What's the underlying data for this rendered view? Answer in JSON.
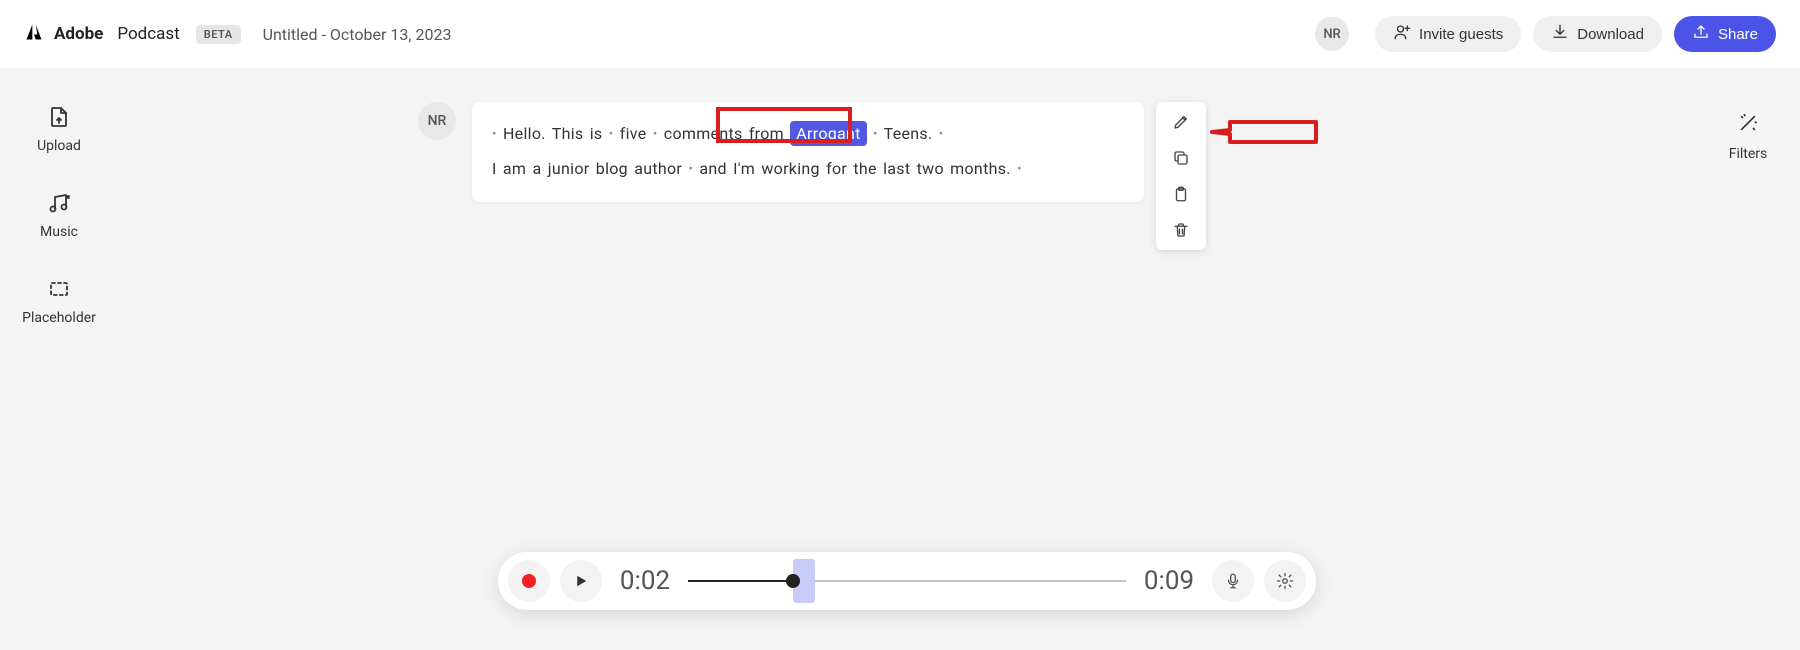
{
  "header": {
    "app_brand": "Adobe",
    "app_name": "Podcast",
    "beta_label": "BETA",
    "doc_title": "Untitled - October 13, 2023",
    "avatar_initials": "NR",
    "invite_label": "Invite guests",
    "download_label": "Download",
    "share_label": "Share"
  },
  "sidebar": {
    "items": [
      {
        "label": "Upload"
      },
      {
        "label": "Music"
      },
      {
        "label": "Placeholder"
      }
    ]
  },
  "right_sidebar": {
    "filters_label": "Filters"
  },
  "transcript": {
    "speaker_initials": "NR",
    "line1_pre": "Hello.  This  is",
    "line1_mid1": "five",
    "line1_mid2": "comments  from",
    "line1_sel": "Arrogant",
    "line1_post": "Teens.",
    "line2_pre": "I  am  a  junior  blog  author",
    "line2_mid": "and  I'm  working  for  the  last  two  months."
  },
  "context_toolbar": {
    "items": [
      {
        "name": "pencil-icon"
      },
      {
        "name": "copy-icon"
      },
      {
        "name": "clipboard-icon"
      },
      {
        "name": "trash-icon"
      }
    ]
  },
  "player": {
    "current_time": "0:02",
    "total_time": "0:09",
    "progress_pct": 24,
    "sel_start_pct": 24,
    "sel_width_pct": 5
  }
}
